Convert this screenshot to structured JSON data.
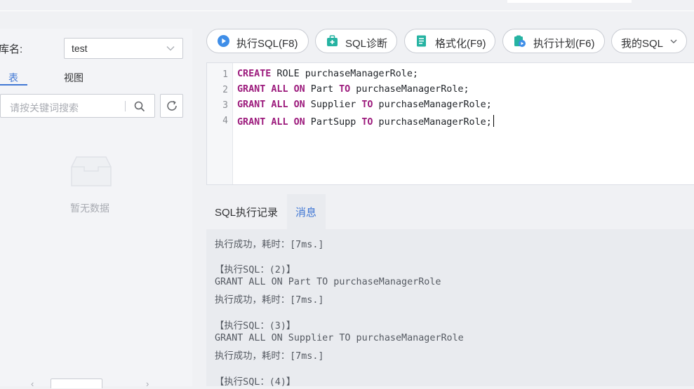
{
  "left_panel": {
    "db_label": "库名:",
    "db_value": "test",
    "tabs": [
      "表",
      "视图"
    ],
    "search_placeholder": "请按关键词搜索",
    "empty_text": "暂无数据"
  },
  "toolbar": {
    "buttons": [
      {
        "label": "执行SQL(F8)",
        "icon": "play-icon"
      },
      {
        "label": "SQL诊断",
        "icon": "diagnose-icon"
      },
      {
        "label": "格式化(F9)",
        "icon": "format-icon"
      },
      {
        "label": "执行计划(F6)",
        "icon": "plan-icon"
      }
    ],
    "my_sql_label": "我的SQL"
  },
  "editor": {
    "lines": [
      {
        "no": "1",
        "kw1": "CREATE",
        "text1": " ROLE purchaseManagerRole;",
        "kw2": "",
        "text2": "",
        "kw3": "",
        "text3": ""
      },
      {
        "no": "2",
        "kw1": "GRANT ALL ON",
        "text1": " Part ",
        "kw2": "TO",
        "text2": " purchaseManagerRole;"
      },
      {
        "no": "3",
        "kw1": "GRANT ALL ON",
        "text1": " Supplier ",
        "kw2": "TO",
        "text2": " purchaseManagerRole;"
      },
      {
        "no": "4",
        "kw1": "GRANT ALL ON",
        "text1": " PartSupp ",
        "kw2": "TO",
        "text2": " purchaseManagerRole;"
      }
    ]
  },
  "result_tabs": [
    "SQL执行记录",
    "消息"
  ],
  "messages": [
    "执行成功，耗时：[7ms.]",
    "【执行SQL：(2)】",
    "GRANT ALL ON Part TO purchaseManagerRole",
    "执行成功，耗时：[7ms.]",
    "【执行SQL：(3)】",
    "GRANT ALL ON Supplier TO purchaseManagerRole",
    "执行成功，耗时：[7ms.]",
    "【执行SQL：(4)】"
  ]
}
